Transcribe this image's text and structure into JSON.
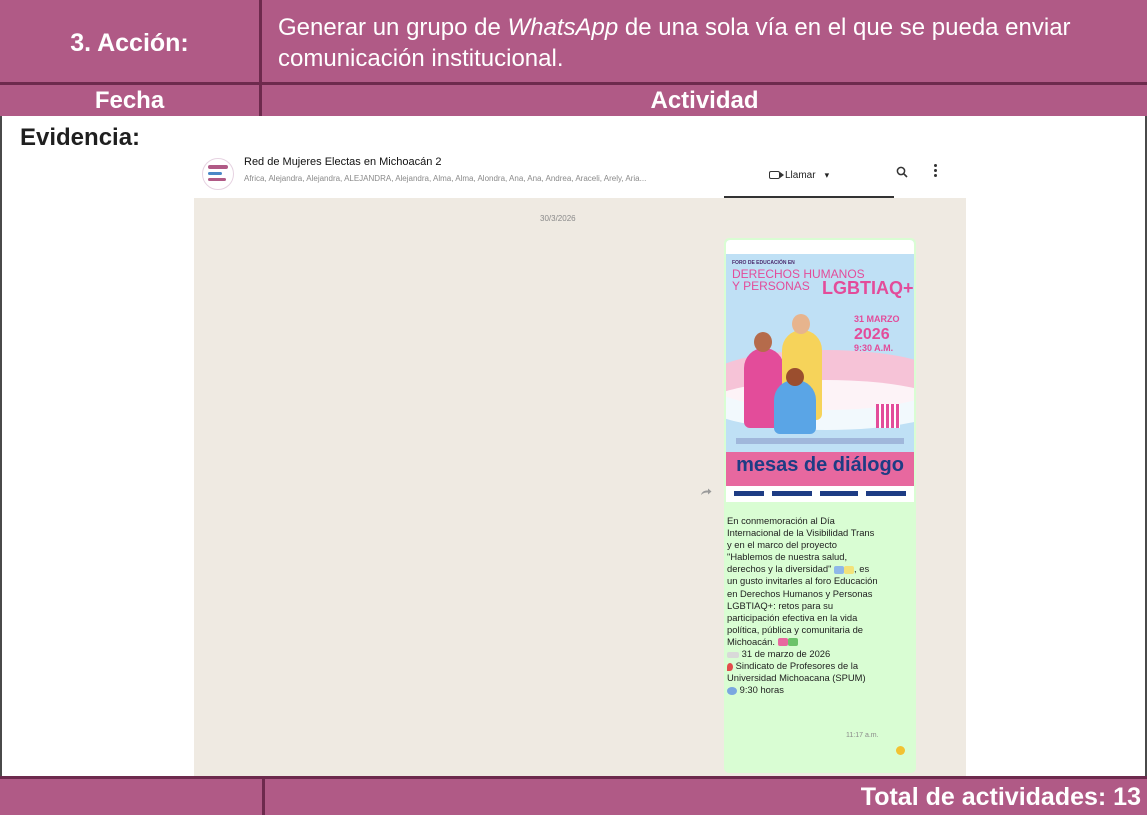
{
  "header": {
    "action_label": "3. Acción:",
    "action_text_before": "Generar un grupo de ",
    "action_text_italic": "WhatsApp",
    "action_text_after": " de una sola vía en el que se pueda enviar comunicación institucional.",
    "col_fecha": "Fecha",
    "col_actividad": "Actividad"
  },
  "evidence_label": "Evidencia:",
  "chat": {
    "group_name": "Red de Mujeres Electas en Michoacán 2",
    "members": "Africa, Alejandra, Alejandra, ALEJANDRA, Alejandra, Alma, Alma, Alondra, Ana, Ana, Andrea, Araceli, Arely, Aria...",
    "call_label": "Llamar",
    "date": "30/3/2026",
    "poster": {
      "foro": "FORO DE EDUCACIÓN EN",
      "derechos": "DERECHOS HUMANOS",
      "personas": "Y PERSONAS",
      "lgbt": "LGBTIAQ+",
      "day": "31 MARZO",
      "year": "2026",
      "time": "9:30 A.M.",
      "mesas": "mesas de diálogo"
    },
    "caption_lines": [
      "En conmemoración al Día",
      "Internacional de la Visibilidad Trans",
      "y en el marco del proyecto",
      "\"Hablemos de nuestra salud,",
      "derechos y la diversidad\"",
      ", es",
      "un gusto invitarles al foro Educación",
      "en Derechos Humanos y Personas",
      "LGBTIAQ+: retos para su",
      "participación efectiva en la vida",
      "política, pública y comunitaria de",
      "Michoacán.",
      "31 de marzo de 2026",
      "Sindicato de Profesores de la",
      "Universidad Michoacana (SPUM)",
      "9:30 horas"
    ],
    "message_time": "11:17 a.m.",
    "colors": {
      "bubble": "#d9fdd3",
      "background": "#efeae2",
      "accent": "#e34c9a"
    }
  },
  "footer": {
    "total_label": "Total de actividades: 13"
  },
  "colors": {
    "table_header": "#b05a86",
    "table_border": "#6d2a4d"
  }
}
